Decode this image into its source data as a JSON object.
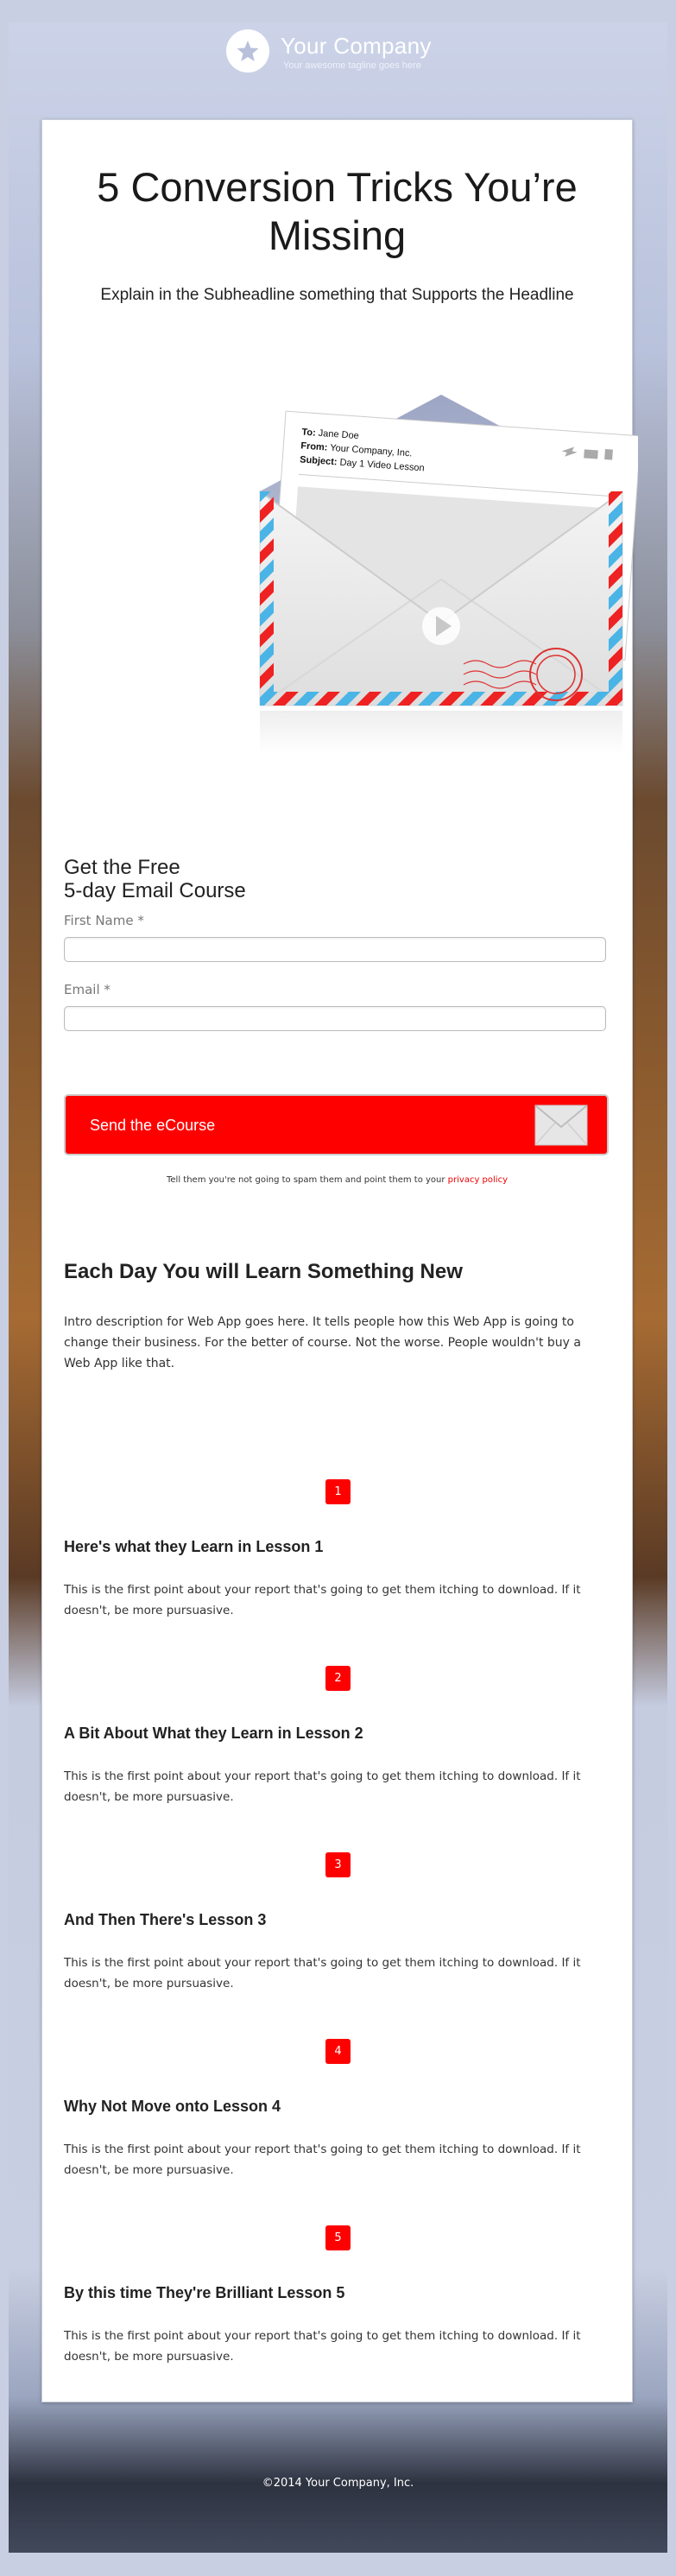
{
  "header": {
    "company_name": "Your Company",
    "tagline": "Your awesome tagline goes here"
  },
  "hero": {
    "headline": "5 Conversion Tricks You’re Missing",
    "subheadline": "Explain in the Subheadline something that Supports the Headline"
  },
  "letter": {
    "to_label": "To:",
    "to_value": "Jane Doe",
    "from_label": "From:",
    "from_value": "Your Company, Inc.",
    "subject_label": "Subject:",
    "subject_value": "Day 1 Video Lesson"
  },
  "form": {
    "title_line1": "Get the Free",
    "title_line2": "5-day Email Course",
    "first_name_label": "First Name *",
    "first_name_value": "",
    "email_label": "Email *",
    "email_value": "",
    "submit_label": "Send the eCourse",
    "privacy_text": "Tell them you're not going to spam them and point them to your ",
    "privacy_link": "privacy policy"
  },
  "course": {
    "title": "Each Day You will Learn Something New",
    "intro": "Intro description for Web App goes here. It tells people how this Web App is going to change their business. For the better of course. Not the worse. People wouldn't buy a Web App like that.",
    "lessons": [
      {
        "number": "1",
        "title": "Here's what they Learn in Lesson 1",
        "text": "This is the first point about your report that's going to get them itching to download. If it doesn't, be more pursuasive."
      },
      {
        "number": "2",
        "title": "A Bit About What they Learn in Lesson 2",
        "text": "This is the first point about your report that's going to get them itching to download. If it doesn't, be more pursuasive."
      },
      {
        "number": "3",
        "title": "And Then There's Lesson 3",
        "text": "This is the first point about your report that's going to get them itching to download. If it doesn't, be more pursuasive."
      },
      {
        "number": "4",
        "title": "Why Not Move onto Lesson 4",
        "text": "This is the first point about your report that's going to get them itching to download. If it doesn't, be more pursuasive."
      },
      {
        "number": "5",
        "title": "By this time They're Brilliant Lesson 5",
        "text": "This is the first point about your report that's going to get them itching to download. If it doesn't, be more pursuasive."
      }
    ]
  },
  "footer": {
    "copyright": "©2014 Your Company, Inc."
  },
  "colors": {
    "accent": "#ff0000",
    "link": "#ee0000"
  }
}
